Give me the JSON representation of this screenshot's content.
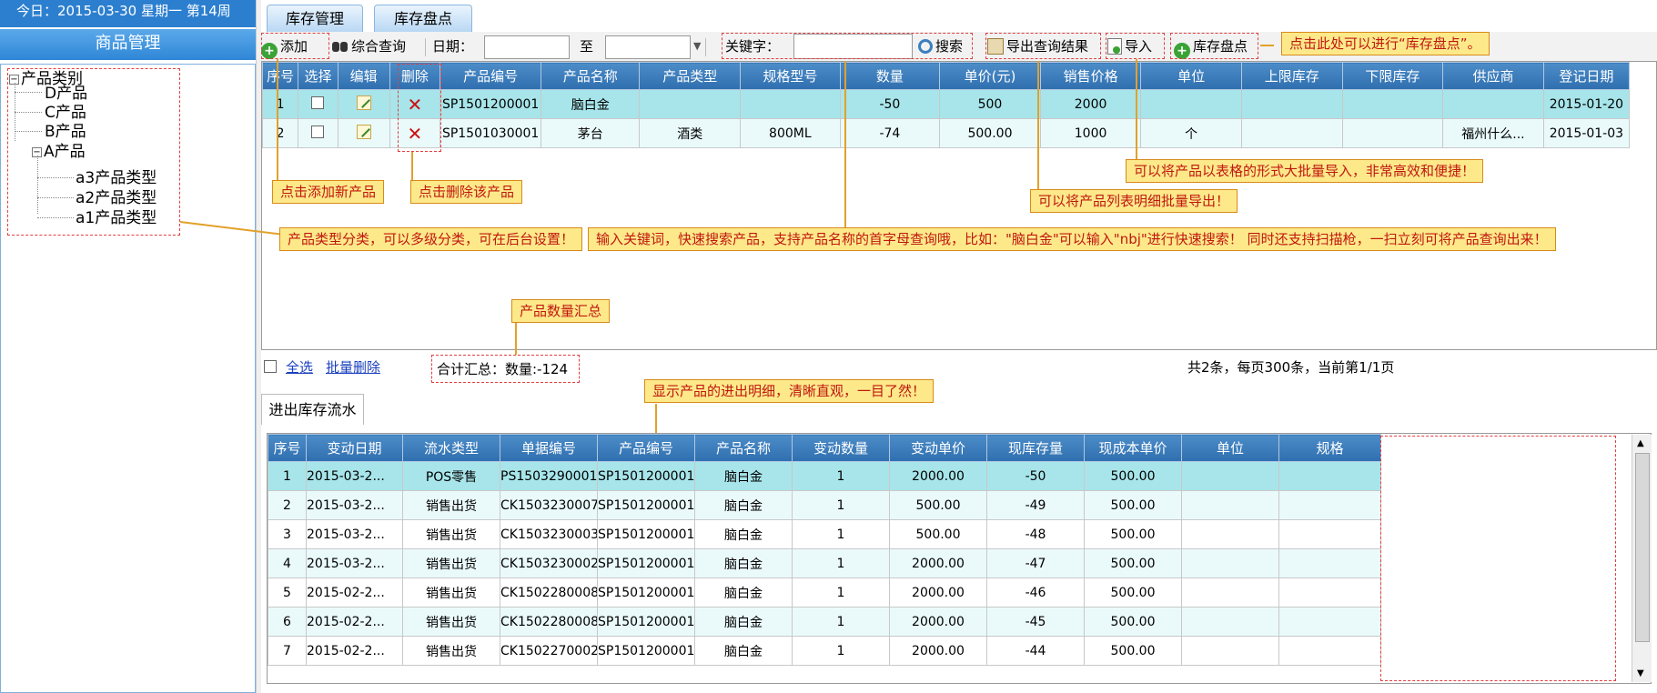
{
  "left": {
    "date_line": "今日：2015-03-30 星期一 第14周",
    "module_title": "商品管理",
    "tree": {
      "root": "产品类别",
      "children": [
        "D产品",
        "C产品",
        "B产品",
        "A产品"
      ],
      "a_children": [
        "a3产品类型",
        "a2产品类型",
        "a1产品类型"
      ]
    }
  },
  "tabs": [
    "库存管理",
    "库存盘点"
  ],
  "toolbar": {
    "add": "添加",
    "query": "综合查询",
    "date_label": "日期：",
    "to_label": "至",
    "keyword_label": "关键字：",
    "search": "搜索",
    "export": "导出查询结果",
    "import": "导入",
    "stocktake": "库存盘点"
  },
  "product_table": {
    "headers": [
      "序号",
      "选择",
      "编辑",
      "删除",
      "产品编号",
      "产品名称",
      "产品类型",
      "规格型号",
      "数量",
      "单价(元)",
      "销售价格",
      "单位",
      "上限库存",
      "下限库存",
      "供应商",
      "登记日期"
    ],
    "rows": [
      [
        "1",
        "",
        "",
        "",
        "SP1501200001",
        "脑白金",
        "",
        "",
        "-50",
        "500",
        "2000",
        "",
        "",
        "",
        "",
        "2015-01-20"
      ],
      [
        "2",
        "",
        "",
        "",
        "SP1501030001",
        "茅台",
        "酒类",
        "800ML",
        "-74",
        "500.00",
        "1000",
        "个",
        "",
        "",
        "福州什么...",
        "2015-01-03"
      ]
    ]
  },
  "footer": {
    "select_all": "全选",
    "batch_delete": "批量删除",
    "total": "合计汇总：数量:-124",
    "paging": "共2条，每页300条，当前第1/1页"
  },
  "flow_tab": "进出库存流水",
  "flow_table": {
    "headers": [
      "序号",
      "变动日期",
      "流水类型",
      "单据编号",
      "产品编号",
      "产品名称",
      "变动数量",
      "变动单价",
      "现库存量",
      "现成本单价",
      "单位",
      "规格"
    ],
    "rows": [
      [
        "1",
        "2015-03-2...",
        "POS零售",
        "PS1503290001",
        "SP1501200001",
        "脑白金",
        "1",
        "2000.00",
        "-50",
        "500.00",
        "",
        ""
      ],
      [
        "2",
        "2015-03-2...",
        "销售出货",
        "CK1503230007",
        "SP1501200001",
        "脑白金",
        "1",
        "500.00",
        "-49",
        "500.00",
        "",
        ""
      ],
      [
        "3",
        "2015-03-2...",
        "销售出货",
        "CK1503230003",
        "SP1501200001",
        "脑白金",
        "1",
        "500.00",
        "-48",
        "500.00",
        "",
        ""
      ],
      [
        "4",
        "2015-03-2...",
        "销售出货",
        "CK1503230002",
        "SP1501200001",
        "脑白金",
        "1",
        "2000.00",
        "-47",
        "500.00",
        "",
        ""
      ],
      [
        "5",
        "2015-02-2...",
        "销售出货",
        "CK1502280008",
        "SP1501200001",
        "脑白金",
        "1",
        "2000.00",
        "-46",
        "500.00",
        "",
        ""
      ],
      [
        "6",
        "2015-02-2...",
        "销售出货",
        "CK1502280008",
        "SP1501200001",
        "脑白金",
        "1",
        "2000.00",
        "-45",
        "500.00",
        "",
        ""
      ],
      [
        "7",
        "2015-02-2...",
        "销售出货",
        "CK1502270002",
        "SP1501200001",
        "脑白金",
        "1",
        "2000.00",
        "-44",
        "500.00",
        "",
        ""
      ]
    ]
  },
  "notes": {
    "stocktake": "点击此处可以进行“库存盘点”。",
    "import": "可以将产品以表格的形式大批量导入，非常高效和便捷！",
    "export": "可以将产品列表明细批量导出！",
    "add": "点击添加新产品",
    "delete": "点击删除该产品",
    "category": "产品类型分类，可以多级分类，可在后台设置！",
    "keyword": "输入关键词，快速搜索产品，支持产品名称的首字母查询哦，比如：\"脑白金\"可以输入\"nbj\"进行快速搜索！ 同时还支持扫描枪，一扫立刻可将产品查询出来！",
    "summary": "产品数量汇总",
    "flow": "显示产品的进出明细，清晰直观，一目了然！"
  },
  "colors": {
    "header_blue": "#2f6faf",
    "selected_row": "#a7e5ea",
    "note_bg": "#fde98a",
    "note_text": "#c0170f"
  }
}
